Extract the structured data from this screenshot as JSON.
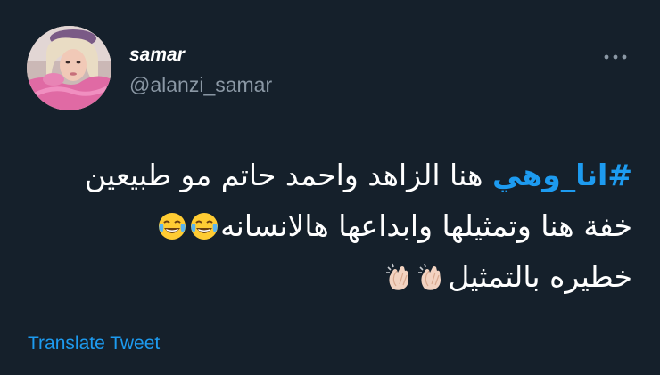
{
  "author": {
    "display_name": "samar",
    "handle": "@alanzi_samar"
  },
  "tweet": {
    "hashtag": "#انا_وهي",
    "line1_text": " هنا الزاهد واحمد حاتم مو طبيعين",
    "line2_text": "خفة هنا وتمثيلها وابداعها هالانسانه",
    "line2_emojis": [
      "face-with-tears-of-joy-icon",
      "face-with-tears-of-joy-icon"
    ],
    "line3_text": "خطيره بالتمثيل",
    "line3_emojis": [
      "clapping-hands-icon",
      "clapping-hands-icon"
    ]
  },
  "actions": {
    "translate_label": "Translate Tweet"
  },
  "colors": {
    "background": "#15202b",
    "accent": "#1d9bf0",
    "secondary_text": "#8b98a5",
    "primary_text": "#ffffff"
  }
}
